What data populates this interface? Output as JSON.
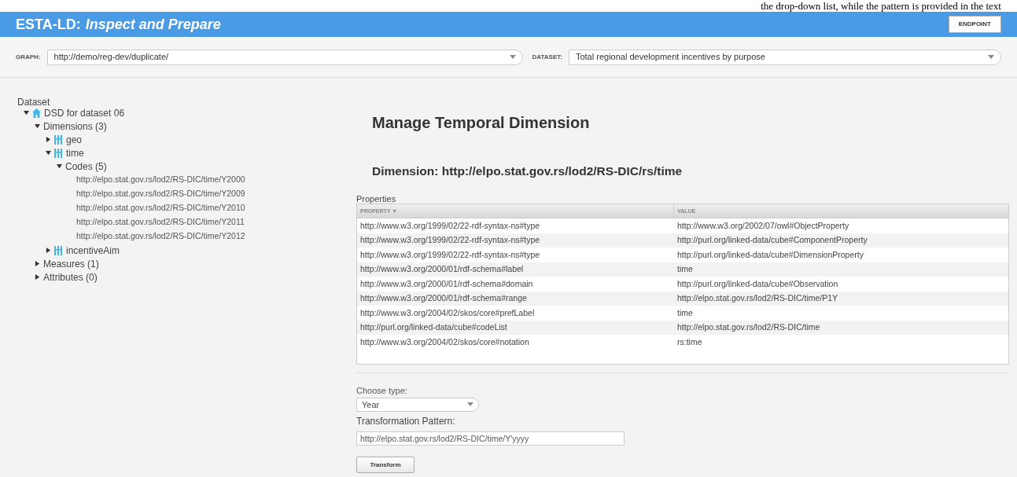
{
  "top_strip": {
    "text": "the drop-down list, while the pattern is provided in the text"
  },
  "header": {
    "title_main": "ESTA-LD:",
    "title_sub": "Inspect and Prepare",
    "button": "ENDPOINT"
  },
  "toolbar": {
    "graph_label": "GRAPH:",
    "graph_value": "http://demo/reg-dev/duplicate/",
    "dataset_label": "DATASET:",
    "dataset_value": "Total regional development incentives by purpose"
  },
  "tree": {
    "title": "Dataset",
    "items": [
      {
        "label": "DSD for dataset 06",
        "kind": "dsd",
        "expanded": true,
        "children": [
          {
            "label": "Dimensions (3)",
            "kind": "group",
            "expanded": true,
            "children": [
              {
                "label": "geo",
                "kind": "dimension",
                "expanded": false
              },
              {
                "label": "time",
                "kind": "dimension",
                "expanded": true,
                "children": [
                  {
                    "label": "Codes (5)",
                    "kind": "group",
                    "expanded": true,
                    "children": [
                      {
                        "label": "http://elpo.stat.gov.rs/lod2/RS-DIC/time/Y2000",
                        "kind": "code"
                      },
                      {
                        "label": "http://elpo.stat.gov.rs/lod2/RS-DIC/time/Y2009",
                        "kind": "code"
                      },
                      {
                        "label": "http://elpo.stat.gov.rs/lod2/RS-DIC/time/Y2010",
                        "kind": "code"
                      },
                      {
                        "label": "http://elpo.stat.gov.rs/lod2/RS-DIC/time/Y2011",
                        "kind": "code"
                      },
                      {
                        "label": "http://elpo.stat.gov.rs/lod2/RS-DIC/time/Y2012",
                        "kind": "code"
                      }
                    ]
                  }
                ]
              },
              {
                "label": "incentiveAim",
                "kind": "dimension",
                "expanded": false
              }
            ]
          },
          {
            "label": "Measures (1)",
            "kind": "group",
            "expanded": false
          },
          {
            "label": "Attributes (0)",
            "kind": "group",
            "expanded": false
          }
        ]
      }
    ]
  },
  "main": {
    "title": "Manage Temporal Dimension",
    "subtitle": "Dimension: http://elpo.stat.gov.rs/lod2/RS-DIC/rs/time",
    "properties_label": "Properties",
    "table": {
      "columns": [
        {
          "label": "PROPERTY",
          "sort": "▼"
        },
        {
          "label": "VALUE"
        }
      ],
      "rows": [
        [
          "http://www.w3.org/1999/02/22-rdf-syntax-ns#type",
          "http://www.w3.org/2002/07/owl#ObjectProperty"
        ],
        [
          "http://www.w3.org/1999/02/22-rdf-syntax-ns#type",
          "http://purl.org/linked-data/cube#ComponentProperty"
        ],
        [
          "http://www.w3.org/1999/02/22-rdf-syntax-ns#type",
          "http://purl.org/linked-data/cube#DimensionProperty"
        ],
        [
          "http://www.w3.org/2000/01/rdf-schema#label",
          "time"
        ],
        [
          "http://www.w3.org/2000/01/rdf-schema#domain",
          "http://purl.org/linked-data/cube#Observation"
        ],
        [
          "http://www.w3.org/2000/01/rdf-schema#range",
          "http://elpo.stat.gov.rs/lod2/RS-DIC/time/P1Y"
        ],
        [
          "http://www.w3.org/2004/02/skos/core#prefLabel",
          "time"
        ],
        [
          "http://purl.org/linked-data/cube#codeList",
          "http://elpo.stat.gov.rs/lod2/RS-DIC/time"
        ],
        [
          "http://www.w3.org/2004/02/skos/core#notation",
          "rs:time"
        ]
      ]
    },
    "type_label": "Choose type:",
    "type_value": "Year",
    "pattern_label": "Transformation Pattern:",
    "pattern_value": "http://elpo.stat.gov.rs/lod2/RS-DIC/time/Y'yyyy",
    "button": "Transform"
  }
}
